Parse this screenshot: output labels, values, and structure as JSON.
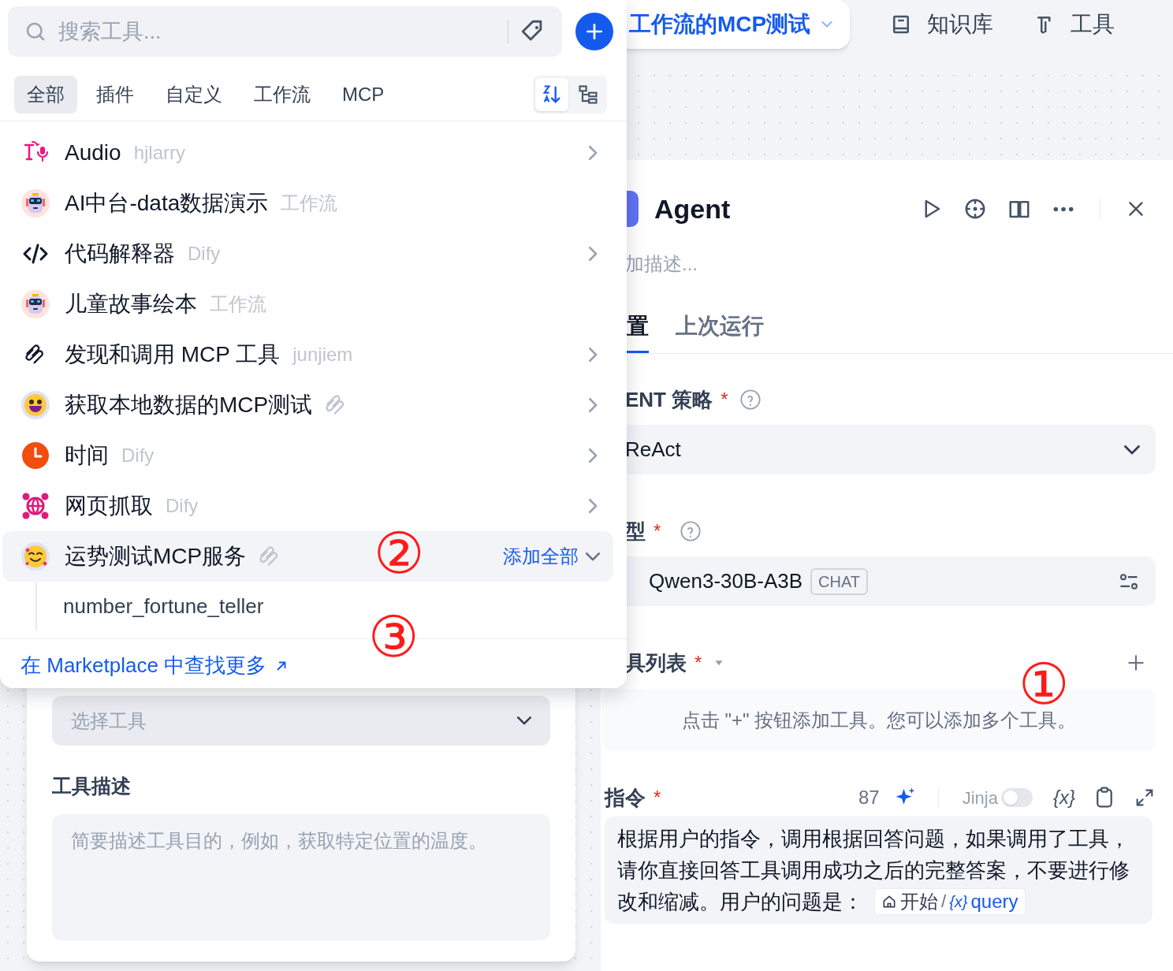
{
  "nav": {
    "workflow_title": "工作流的MCP测试",
    "links": [
      {
        "label": "知识库"
      },
      {
        "label": "工具"
      }
    ]
  },
  "popover": {
    "search": {
      "placeholder": "搜索工具..."
    },
    "filters": [
      {
        "label": "全部",
        "selected": true
      },
      {
        "label": "插件",
        "selected": false
      },
      {
        "label": "自定义",
        "selected": false
      },
      {
        "label": "工作流",
        "selected": false
      },
      {
        "label": "MCP",
        "selected": false
      }
    ],
    "view_toggle": [
      {
        "selected": true
      },
      {
        "selected": false
      }
    ],
    "tools": [
      {
        "name": "Audio",
        "kind": "plugin",
        "source": "hjlarry",
        "selected": false,
        "expanded": false
      },
      {
        "name": "AI中台-data数据演示",
        "kind": "workflow",
        "source": "工作流",
        "selected": false
      },
      {
        "name": "代码解释器",
        "kind": "plugin",
        "source": "Dify",
        "selected": false,
        "expanded": false
      },
      {
        "name": "儿童故事绘本",
        "kind": "workflow",
        "source": "工作流",
        "selected": false
      },
      {
        "name": "发现和调用 MCP 工具",
        "kind": "plugin",
        "source": "junjiem",
        "selected": false,
        "expanded": false
      },
      {
        "name": "获取本地数据的MCP测试",
        "kind": "mcp",
        "selected": false,
        "expanded": false
      },
      {
        "name": "时间",
        "kind": "plugin",
        "source": "Dify",
        "selected": false,
        "expanded": false
      },
      {
        "name": "网页抓取",
        "kind": "plugin",
        "source": "Dify",
        "selected": false,
        "expanded": false
      },
      {
        "name": "运势测试MCP服务",
        "kind": "mcp",
        "selected": true,
        "expanded": true,
        "action": "添加全部",
        "children": [
          {
            "name": "number_fortune_teller"
          }
        ]
      }
    ],
    "footer_link": "在 Marketplace 中查找更多"
  },
  "agent_panel": {
    "title": "Agent",
    "description_placeholder": "加描述...",
    "tabs": [
      {
        "label": "置",
        "selected": true
      },
      {
        "label": "上次运行",
        "selected": false
      }
    ],
    "strategy": {
      "label": "ENT 策略",
      "required_mark": "*",
      "value": "ReAct"
    },
    "model": {
      "label": "型",
      "required_mark": "*",
      "value": "Qwen3-30B-A3B",
      "badge": "CHAT"
    },
    "tool_list": {
      "label": "具列表",
      "required_mark": "*",
      "empty_text": "点击 \"+\" 按钮添加工具。您可以添加多个工具。"
    },
    "instruction": {
      "label": "指令",
      "required_mark": "*",
      "count": "87",
      "jinja": {
        "label": "Jinja",
        "on": false
      },
      "var_button": "{x}",
      "text_lines": [
        "根据用户的指令，调用根据回答问题，如果调用了工具，",
        "请你直接回答工具调用成功之后的完整答案，不要进行修",
        "改和缩减。用户的问题是："
      ],
      "chip": {
        "node": "开始",
        "separator": "/",
        "var_icon": "{x}",
        "variable": "query"
      }
    }
  },
  "tool_card": {
    "select_placeholder": "选择工具",
    "description_label": "工具描述",
    "description_placeholder": "简要描述工具目的，例如，获取特定位置的温度。"
  },
  "annotations": [
    {
      "label": "①"
    },
    {
      "label": "②"
    },
    {
      "label": "③"
    }
  ]
}
